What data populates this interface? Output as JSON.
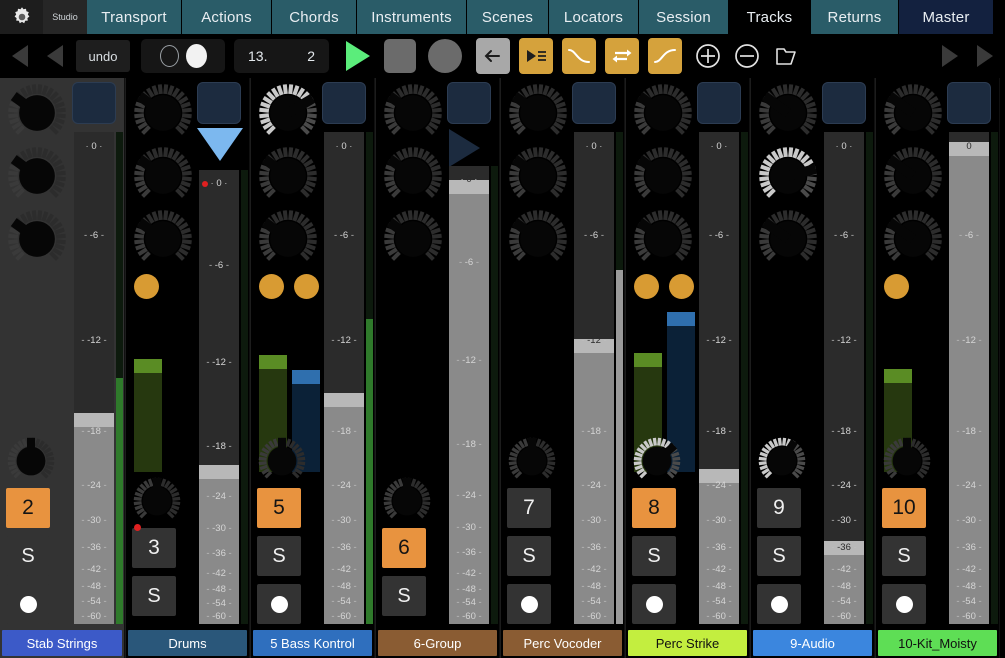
{
  "tabs": [
    {
      "label": "Transport",
      "style": "teal"
    },
    {
      "label": "Actions",
      "style": "teal"
    },
    {
      "label": "Chords",
      "style": "teal"
    },
    {
      "label": "Instruments",
      "style": "teal"
    },
    {
      "label": "Scenes",
      "style": "teal"
    },
    {
      "label": "Locators",
      "style": "teal"
    },
    {
      "label": "Session",
      "style": "teal"
    },
    {
      "label": "Tracks",
      "style": "active"
    },
    {
      "label": "Returns",
      "style": "teal"
    },
    {
      "label": "Master",
      "style": "navy"
    }
  ],
  "header": {
    "studio_label": "Studio",
    "gear_icon": "gear-icon"
  },
  "toolbar": {
    "undo_label": "undo",
    "position_bar": "13.",
    "position_beat": "2",
    "icons": [
      "skip-back-icon",
      "prev-icon",
      "undo-button",
      "loop-circles",
      "position-display",
      "play-icon",
      "stop-icon",
      "record-icon",
      "back-arrow-icon",
      "list-play-icon",
      "fade-out-icon",
      "loop-icon",
      "fade-in-icon",
      "plus-icon",
      "minus-icon",
      "folder-icon",
      "next-icon",
      "skip-forward-icon"
    ]
  },
  "scale_ticks": [
    "0",
    "-6",
    "-12",
    "-18",
    "-24",
    "-30",
    "-36",
    "-42",
    "-48",
    "-54",
    "-60"
  ],
  "tracks": [
    {
      "name": "Stab Strings",
      "color": "#3c5ac8",
      "text_color": "#ffffff",
      "number": "2",
      "number_active": true,
      "solo": "S",
      "arm_visible": true,
      "selected": true,
      "rec_led": false,
      "knobs": [
        {
          "val": 0.3,
          "bright": false
        },
        {
          "val": 0.3,
          "bright": false
        },
        {
          "val": 0.3,
          "bright": false
        }
      ],
      "pan": {
        "val": 0.5,
        "bright": false
      },
      "sends": 0,
      "top_widget": "blue-square",
      "fader_db": "-12",
      "fader_pos": 0.415,
      "vu_green": 0,
      "vu_blue": 0,
      "out_meter": 0.5,
      "out_meter_color": "#2f7a2b"
    },
    {
      "name": "Drums",
      "color": "#2a577a",
      "text_color": "#ffffff",
      "number": "3",
      "number_active": false,
      "solo": "S",
      "arm_visible": false,
      "selected": false,
      "rec_led": true,
      "knobs": [
        {
          "val": 0.3,
          "bright": false
        },
        {
          "val": 0.3,
          "bright": false
        },
        {
          "val": 0.3,
          "bright": false
        }
      ],
      "pan": {
        "val": 0.5,
        "bright": false
      },
      "sends": 1,
      "top_widget": "blue-triangle-down",
      "fader_db": "-16",
      "fader_pos": 0.335,
      "vu_green": 0.7,
      "vu_blue": 0,
      "out_meter": 0,
      "out_meter_color": "#2f7a2b"
    },
    {
      "name": "5 Bass Kontrol",
      "color": "#2f6fbe",
      "text_color": "#ffffff",
      "number": "5",
      "number_active": true,
      "solo": "S",
      "arm_visible": true,
      "selected": false,
      "rec_led": false,
      "knobs": [
        {
          "val": 0.72,
          "bright": true
        },
        {
          "val": 0.3,
          "bright": false
        },
        {
          "val": 0.3,
          "bright": false
        }
      ],
      "pan": {
        "val": 0.5,
        "bright": false
      },
      "sends": 2,
      "top_widget": "blue-square",
      "fader_db": "-11",
      "fader_pos": 0.455,
      "vu_green": 0.72,
      "vu_blue": 0.63,
      "out_meter": 0.62,
      "out_meter_color": "#2f7a2b"
    },
    {
      "name": "6-Group",
      "color": "#8a5c33",
      "text_color": "#ffffff",
      "number": "6",
      "number_active": true,
      "solo": "S",
      "arm_visible": false,
      "selected": false,
      "rec_led": false,
      "knobs": [
        {
          "val": 0.3,
          "bright": false
        },
        {
          "val": 0.3,
          "bright": false
        },
        {
          "val": 0.3,
          "bright": false
        }
      ],
      "pan": {
        "val": 0.5,
        "bright": false
      },
      "sends": 0,
      "top_widget": "navy-triangle-right",
      "fader_db": "0",
      "fader_pos": 0.955,
      "vu_green": 0,
      "vu_blue": 0,
      "out_meter": 0,
      "out_meter_color": "#2f7a2b"
    },
    {
      "name": "Perc Vocoder",
      "color": "#8a5c33",
      "text_color": "#ffffff",
      "number": "7",
      "number_active": false,
      "solo": "S",
      "arm_visible": true,
      "selected": false,
      "rec_led": false,
      "knobs": [
        {
          "val": 0.3,
          "bright": false
        },
        {
          "val": 0.3,
          "bright": false
        },
        {
          "val": 0.3,
          "bright": false
        }
      ],
      "pan": {
        "val": 0.5,
        "bright": false
      },
      "sends": 0,
      "top_widget": "blue-square",
      "fader_db": "-9",
      "fader_pos": 0.565,
      "vu_green": 0,
      "vu_blue": 0,
      "out_meter": 0.72,
      "out_meter_color": "#9a9a9a"
    },
    {
      "name": "Perc Strike",
      "color": "#c3ee3f",
      "text_color": "#111111",
      "number": "8",
      "number_active": true,
      "solo": "S",
      "arm_visible": true,
      "selected": false,
      "rec_led": false,
      "knobs": [
        {
          "val": 0.3,
          "bright": false
        },
        {
          "val": 0.3,
          "bright": false
        },
        {
          "val": 0.3,
          "bright": false
        }
      ],
      "pan": {
        "val": 0.68,
        "bright": true
      },
      "sends": 2,
      "top_widget": "blue-square",
      "fader_db": "-18",
      "fader_pos": 0.3,
      "vu_green": 0.735,
      "vu_blue": 0.985,
      "out_meter": 0,
      "out_meter_color": "#2f7a2b"
    },
    {
      "name": "9-Audio",
      "color": "#3b86de",
      "text_color": "#ffffff",
      "number": "9",
      "number_active": false,
      "solo": "S",
      "arm_visible": true,
      "selected": false,
      "rec_led": false,
      "knobs": [
        {
          "val": 0.3,
          "bright": false
        },
        {
          "val": 0.78,
          "bright": true
        },
        {
          "val": 0.3,
          "bright": false
        }
      ],
      "pan": {
        "val": 0.62,
        "bright": true
      },
      "sends": 0,
      "top_widget": "blue-square",
      "fader_db": "-24",
      "fader_pos": 0.155,
      "vu_green": 0,
      "vu_blue": 0,
      "out_meter": 0,
      "out_meter_color": "#2f7a2b"
    },
    {
      "name": "10-Kit_Moisty",
      "color": "#5ede55",
      "text_color": "#111111",
      "number": "10",
      "number_active": true,
      "solo": "S",
      "arm_visible": true,
      "selected": false,
      "rec_led": false,
      "knobs": [
        {
          "val": 0.3,
          "bright": false
        },
        {
          "val": 0.3,
          "bright": false
        },
        {
          "val": 0.3,
          "bright": false
        }
      ],
      "pan": {
        "val": 0.5,
        "bright": false
      },
      "sends": 1,
      "top_widget": "blue-square",
      "fader_db": "0",
      "fader_pos": 0.965,
      "vu_green": 0.635,
      "vu_blue": 0,
      "out_meter": 0,
      "out_meter_color": "#2f7a2b"
    }
  ]
}
